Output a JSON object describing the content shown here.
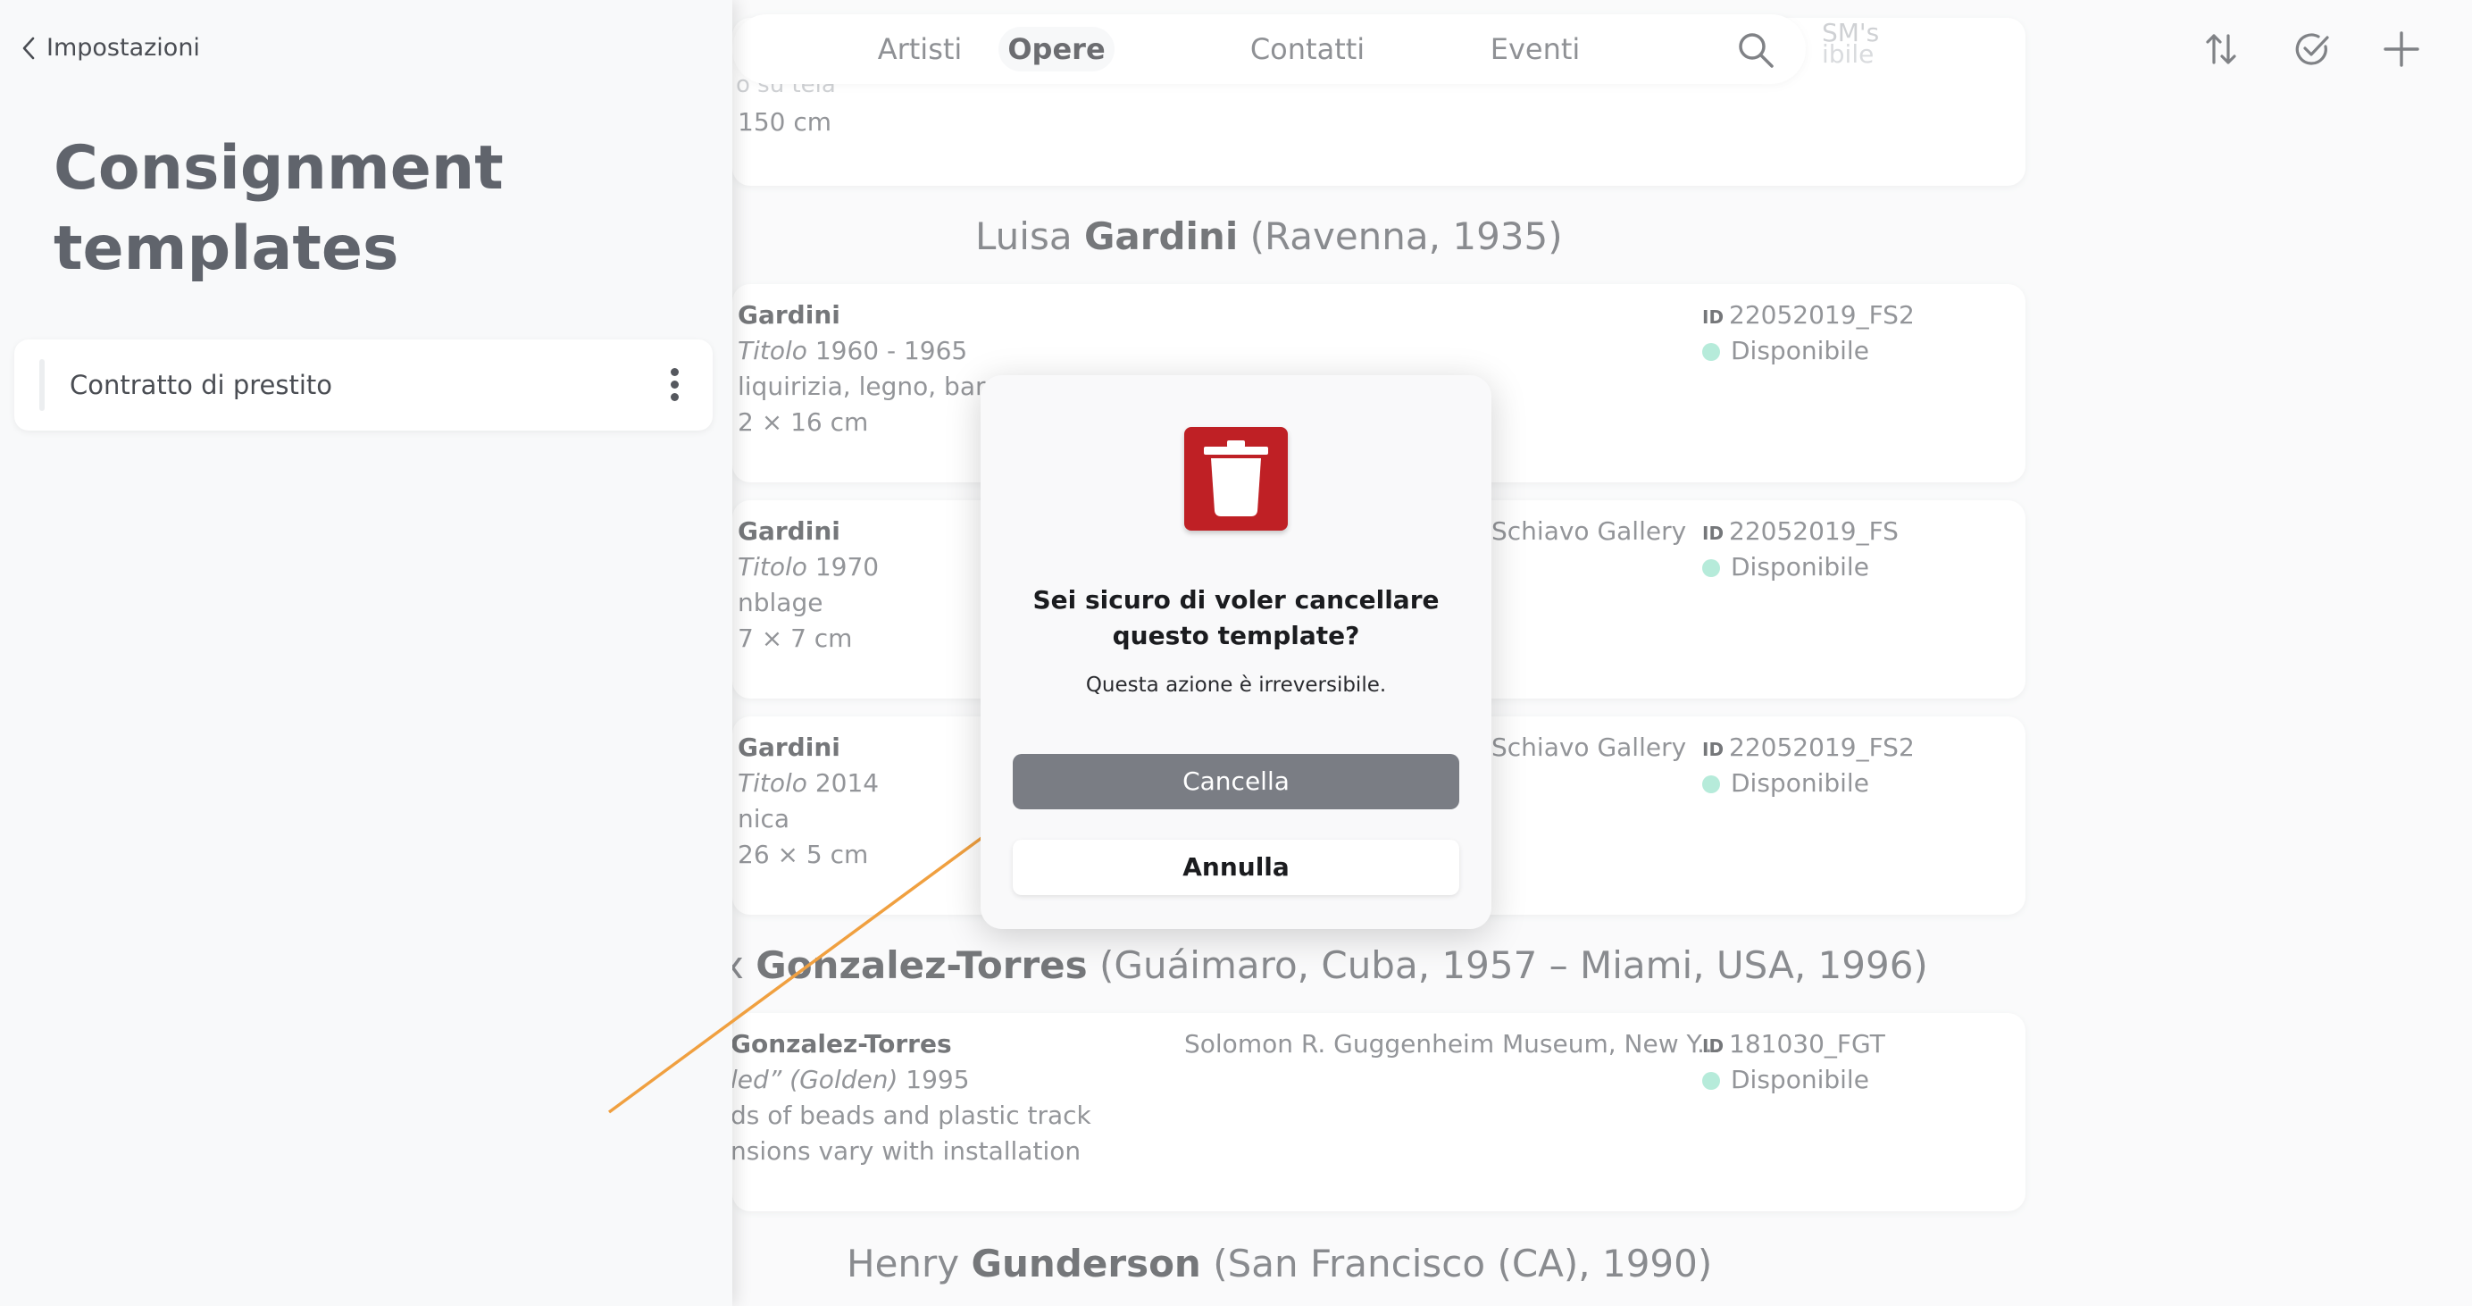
{
  "nav": {
    "tabs": [
      {
        "label": "Artisti",
        "active": false
      },
      {
        "label": "Opere",
        "active": true
      },
      {
        "label": "Contatti",
        "active": false
      },
      {
        "label": "Eventi",
        "active": false
      }
    ],
    "search_icon": "search-icon"
  },
  "toolbar": {
    "icons": [
      "sort-icon",
      "check-circle-icon",
      "plus-icon"
    ]
  },
  "partial_top": {
    "fragment_1": "o su tela",
    "dimensions": "150 cm",
    "fragment_2": "SM's",
    "fragment_3": "ibile"
  },
  "artists": [
    {
      "name_first": "Luisa",
      "name_last": "Gardini",
      "details": "(Ravenna, 1935)",
      "works": [
        {
          "artist": "Gardini",
          "title": "Titolo",
          "year": "1960 - 1965",
          "medium": "liquirizia, legno, barat",
          "dimensions": "2 × 16 cm",
          "location": "",
          "id": "22052019_FS2",
          "status": "Disponibile"
        },
        {
          "artist": "Gardini",
          "title": "Titolo",
          "year": "1970",
          "medium": "nblage",
          "dimensions": "7 × 7 cm",
          "location": "Schiavo Gallery",
          "id": "22052019_FS",
          "status": "Disponibile"
        },
        {
          "artist": "Gardini",
          "title": "Titolo",
          "year": "2014",
          "medium": "nica",
          "dimensions": "26 × 5 cm",
          "location": "Schiavo Gallery",
          "id": "22052019_FS2",
          "status": "Disponibile"
        }
      ]
    },
    {
      "name_first": "x",
      "name_last": "Gonzalez-Torres",
      "details": "(Guáimaro, Cuba, 1957 – Miami, USA, 1996)",
      "works": [
        {
          "artist": "Gonzalez-Torres",
          "title": "led” (Golden)",
          "year": "1995",
          "medium": "ds of beads and plastic track",
          "dimensions": "nsions vary with installation",
          "location": "Solomon R. Guggenheim Museum, New Y...",
          "id": "181030_FGT",
          "status": "Disponibile"
        }
      ]
    },
    {
      "name_first": "Henry",
      "name_last": "Gunderson",
      "details": "(San Francisco (CA), 1990)",
      "works": []
    }
  ],
  "id_label": "ID",
  "status_color": "#8fe0c6",
  "panel": {
    "back_label": "Impostazioni",
    "title": "Consignment templates",
    "templates": [
      {
        "label": "Contratto di prestito"
      }
    ]
  },
  "modal": {
    "icon": "trash-icon",
    "icon_color": "#bf2025",
    "title": "Sei sicuro di voler cancellare questo template?",
    "subtitle": "Questa azione è irreversibile.",
    "confirm_label": "Cancella",
    "cancel_label": "Annulla"
  },
  "annotation_arrow_color": "#f0a040"
}
